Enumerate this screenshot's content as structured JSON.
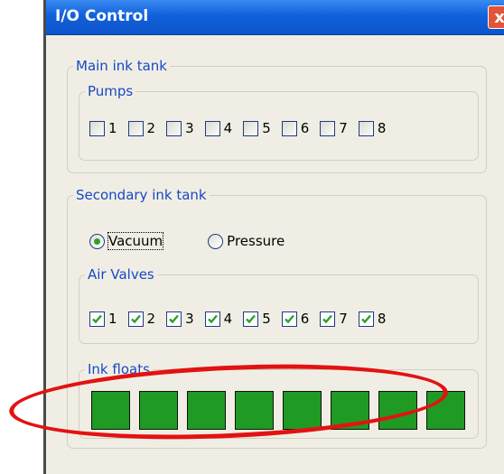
{
  "window": {
    "title": "I/O Control",
    "close_glyph": "x"
  },
  "main_tank": {
    "legend": "Main ink tank",
    "pumps": {
      "legend": "Pumps",
      "items": [
        {
          "label": "1",
          "checked": false
        },
        {
          "label": "2",
          "checked": false
        },
        {
          "label": "3",
          "checked": false
        },
        {
          "label": "4",
          "checked": false
        },
        {
          "label": "5",
          "checked": false
        },
        {
          "label": "6",
          "checked": false
        },
        {
          "label": "7",
          "checked": false
        },
        {
          "label": "8",
          "checked": false
        }
      ]
    }
  },
  "secondary_tank": {
    "legend": "Secondary ink tank",
    "mode": {
      "options": [
        {
          "label": "Vacuum",
          "selected": true
        },
        {
          "label": "Pressure",
          "selected": false
        }
      ]
    },
    "air_valves": {
      "legend": "Air Valves",
      "items": [
        {
          "label": "1",
          "checked": true
        },
        {
          "label": "2",
          "checked": true
        },
        {
          "label": "3",
          "checked": true
        },
        {
          "label": "4",
          "checked": true
        },
        {
          "label": "5",
          "checked": true
        },
        {
          "label": "6",
          "checked": true
        },
        {
          "label": "7",
          "checked": true
        },
        {
          "label": "8",
          "checked": true
        }
      ]
    },
    "ink_floats": {
      "legend": "Ink floats",
      "count": 8,
      "color": "#1f9a22"
    }
  },
  "annotation": {
    "color": "#e31212"
  },
  "checkbox_checkmark_color": "#2aa12a"
}
